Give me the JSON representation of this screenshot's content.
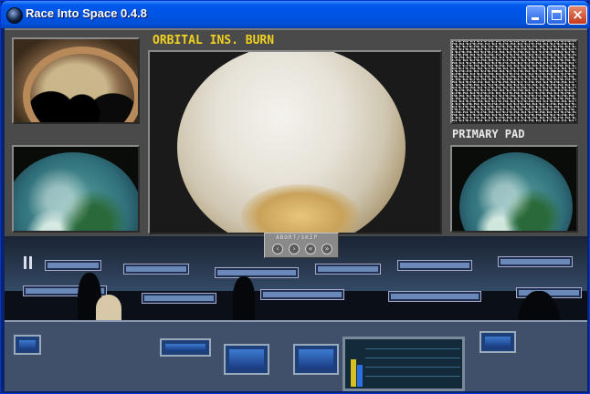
{
  "window": {
    "title": "Race Into Space 0.4.8",
    "buttons": {
      "minimize": "minimize",
      "maximize": "maximize",
      "close": "×"
    }
  },
  "console": {
    "mission_label": "ORBITAL INS. BURN",
    "pad_label": "PRIMARY PAD"
  },
  "controls": {
    "panel_label": "ABORT/SKIP",
    "buttons": [
      "‹",
      "›",
      "«",
      "»"
    ]
  },
  "colors": {
    "label_yellow": "#f0d020",
    "console_gray": "#4a4a4a",
    "titlebar_blue": "#0054e3"
  },
  "icons": [
    "app-globe-icon",
    "pause-icon"
  ]
}
